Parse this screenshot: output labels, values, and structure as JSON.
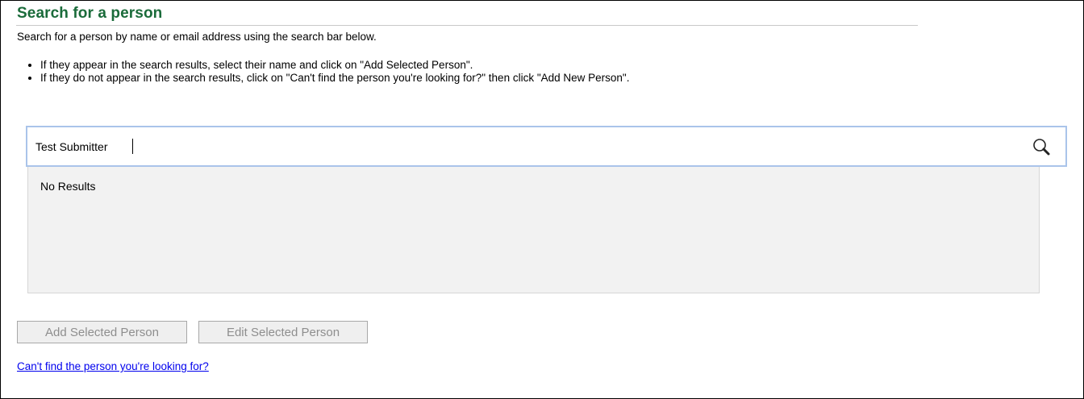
{
  "header": {
    "title": "Search for a person",
    "intro": "Search for a person by name or email address using the search bar below."
  },
  "instructions": [
    "If they appear in the search results, select their name and click on \"Add Selected Person\".",
    "If they do not appear in the search results, click on \"Can't find the person you're looking for?\" then click \"Add New Person\"."
  ],
  "search": {
    "value": "Test Submitter",
    "icon": "search-icon"
  },
  "results": {
    "empty_message": "No Results"
  },
  "actions": {
    "add_label": "Add Selected Person",
    "edit_label": "Edit Selected Person"
  },
  "links": {
    "cant_find": "Can't find the person you're looking for?"
  },
  "colors": {
    "title": "#1a6b3a",
    "search_border": "#aac4ea",
    "results_bg": "#f2f2f2",
    "link": "#0000ee"
  }
}
